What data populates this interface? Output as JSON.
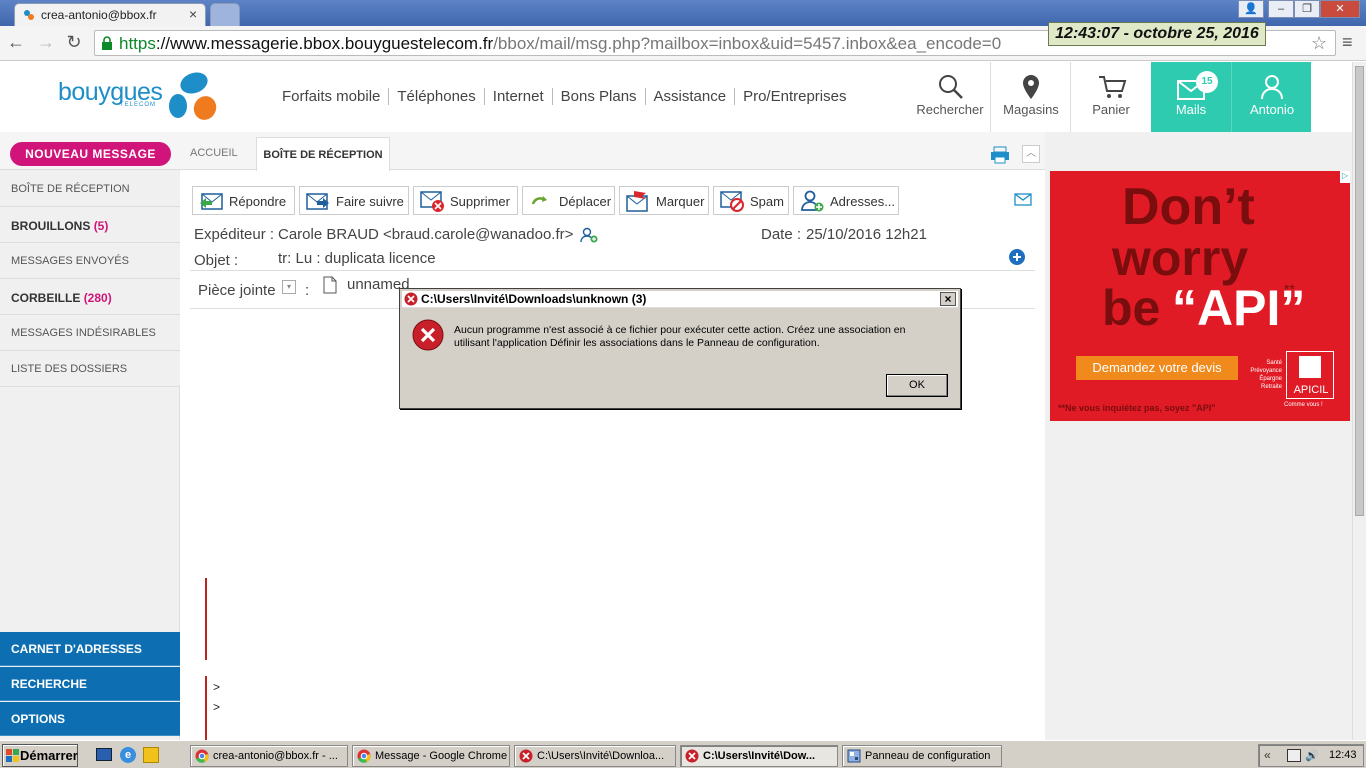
{
  "browser": {
    "tab_title": "crea-antonio@bbox.fr",
    "url_scheme": "https",
    "url_host": "://www.messagerie.bbox.bouyguestelecom.fr",
    "url_path": "/bbox/mail/msg.php?mailbox=inbox&uid=5457.inbox&ea_encode=0"
  },
  "clock_overlay": "12:43:07  - octobre 25, 2016",
  "site": {
    "logo": "bouygues",
    "logo_sub": "TELECOM",
    "nav": [
      "Forfaits mobile",
      "Téléphones",
      "Internet",
      "Bons Plans",
      "Assistance",
      "Pro/Entreprises"
    ],
    "header_items": {
      "search": "Rechercher",
      "stores": "Magasins",
      "cart": "Panier",
      "mails": "Mails",
      "mails_count": "15",
      "account": "Antonio"
    }
  },
  "mail": {
    "new_message": "NOUVEAU MESSAGE",
    "tab_home": "ACCUEIL",
    "tab_inbox": "BOÎTE DE RÉCEPTION",
    "folders": [
      {
        "label": "BOÎTE DE RÉCEPTION",
        "count": ""
      },
      {
        "label": "BROUILLONS",
        "count": "(5)"
      },
      {
        "label": "MESSAGES ENVOYÉS",
        "count": ""
      },
      {
        "label": "CORBEILLE",
        "count": "(280)"
      },
      {
        "label": "MESSAGES INDÉSIRABLES",
        "count": ""
      },
      {
        "label": "LISTE DES DOSSIERS",
        "count": ""
      }
    ],
    "bottom_buttons": [
      "CARNET D'ADRESSES",
      "RECHERCHE",
      "OPTIONS"
    ],
    "toolbar": [
      "Répondre",
      "Faire suivre",
      "Supprimer",
      "Déplacer",
      "Marquer",
      "Spam",
      "Adresses..."
    ],
    "sender_label": "Expéditeur :",
    "sender_value": "Carole BRAUD <braud.carole@wanadoo.fr>",
    "date_label": "Date :",
    "date_value": "25/10/2016 12h21",
    "subject_label": "Objet :",
    "subject_value": "tr: Lu : duplicata licence",
    "attachment_label": "Pièce jointe",
    "attachment_colon": ":",
    "attachment_name": "unnamed",
    "body_quotes": [
      ">",
      ">"
    ]
  },
  "ad": {
    "line1": "Don’t",
    "line2": "worry",
    "line3a": "be",
    "line3b": "“API”",
    "stars": "**",
    "cta": "Demandez votre devis",
    "tags": "Santé Prévoyance Épargne Retraite",
    "brand": "APICIL",
    "slogan": "Comme vous !",
    "footnote": "**Ne vous inquiétez pas, soyez \"API\""
  },
  "dialog": {
    "title": "C:\\Users\\Invité\\Downloads\\unknown (3)",
    "close": "×",
    "message": "Aucun programme n'est associé à ce fichier pour exécuter cette action. Créez une association en utilisant l'application Définir les associations dans le Panneau de configuration.",
    "ok": "OK"
  },
  "taskbar": {
    "start": "Démarrer",
    "tasks": [
      "crea-antonio@bbox.fr - ...",
      "Message - Google Chrome",
      "C:\\Users\\Invité\\Downloa...",
      "C:\\Users\\Invité\\Dow...",
      "Panneau de configuration"
    ],
    "tray_arrow": "«",
    "time": "12:43"
  },
  "colors": {
    "brand_blue": "#1e8ec8",
    "accent_pink": "#d1147a",
    "header_green": "#2ecbb0",
    "sidebar_blue": "#0d6fb1",
    "ad_red": "#e01b25"
  }
}
